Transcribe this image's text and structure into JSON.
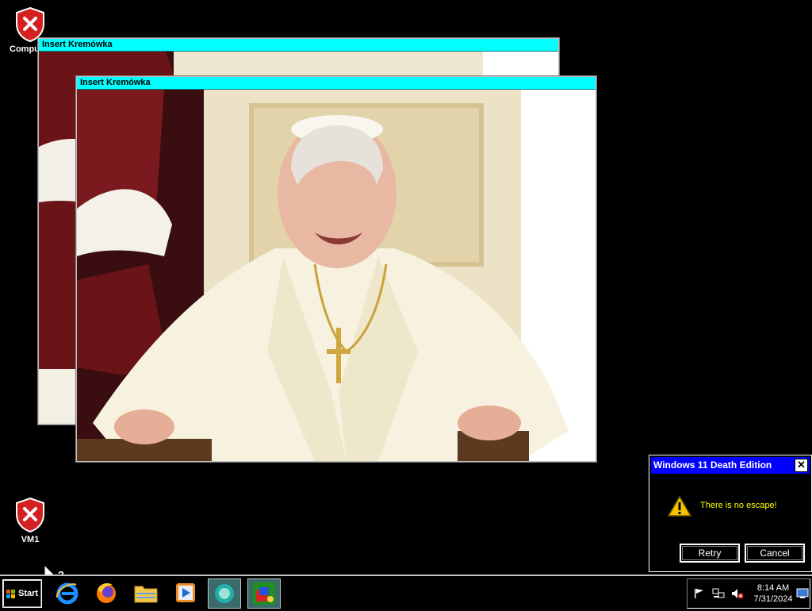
{
  "desktop": {
    "icons": [
      {
        "label": "Computer",
        "icon": "shield-error-icon"
      },
      {
        "label": "VM1",
        "icon": "shield-error-icon"
      }
    ]
  },
  "image_windows": [
    {
      "title": "Insert Kremówka"
    },
    {
      "title": "Insert Kremówka"
    }
  ],
  "dialog": {
    "title": "Windows 11 Death Edition",
    "message": "There is no escape!",
    "retry_label": "Retry",
    "cancel_label": "Cancel",
    "icon": "warning-icon",
    "title_color": "#0000ff",
    "message_color": "#ffff00"
  },
  "taskbar": {
    "start_label": "Start",
    "apps": [
      "internet-explorer-icon",
      "firefox-icon",
      "file-explorer-icon",
      "media-player-icon",
      "messenger-icon",
      "paint-icon"
    ],
    "tray_icons": [
      "action-center-flag-icon",
      "network-icon",
      "volume-muted-icon",
      "show-desktop-icon"
    ],
    "time": "8:14 AM",
    "date": "7/31/2024"
  },
  "colors": {
    "window_titlebar": "#00ffff",
    "desktop_background": "#000000"
  }
}
